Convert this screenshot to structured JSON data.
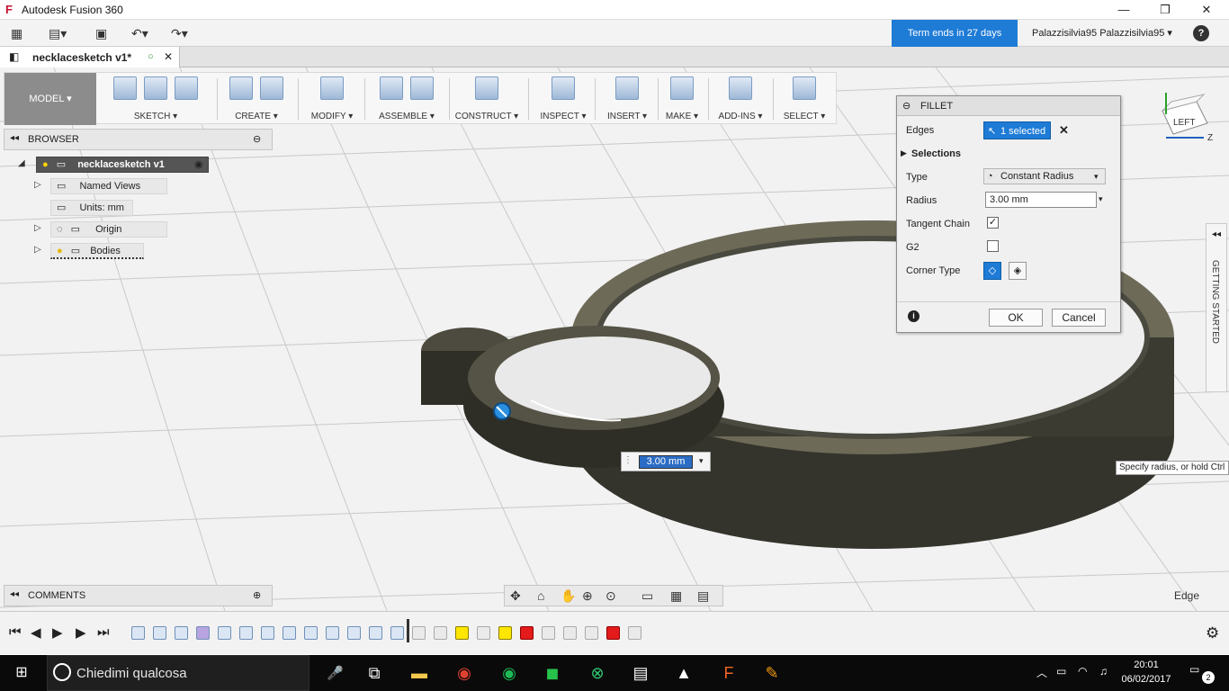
{
  "window": {
    "title": "Autodesk Fusion 360",
    "min": "—",
    "max": "❐",
    "close": "✕"
  },
  "appbar": {
    "term": "Term ends in 27 days",
    "user": "Palazzisilvia95 Palazzisilvia95 ▾",
    "help": "?"
  },
  "document": {
    "tab_name": "necklacesketch v1*"
  },
  "toolbar": {
    "workspace": "MODEL ▾",
    "groups": [
      "SKETCH ▾",
      "CREATE ▾",
      "MODIFY ▾",
      "ASSEMBLE ▾",
      "CONSTRUCT ▾",
      "INSPECT ▾",
      "INSERT ▾",
      "MAKE ▾",
      "ADD-INS ▾",
      "SELECT ▾"
    ]
  },
  "browser": {
    "title": "BROWSER",
    "root": "necklacesketch v1",
    "items": [
      "Named Views",
      "Units: mm",
      "Origin",
      "Bodies"
    ]
  },
  "viewcube": {
    "face": "LEFT",
    "axis": "Z"
  },
  "fillet": {
    "title": "FILLET",
    "edges_label": "Edges",
    "edges_value": "1 selected",
    "selections_label": "Selections",
    "type_label": "Type",
    "type_value": "Constant Radius",
    "radius_label": "Radius",
    "radius_value": "3.00 mm",
    "tangent_label": "Tangent Chain",
    "g2_label": "G2",
    "corner_label": "Corner Type",
    "ok": "OK",
    "cancel": "Cancel"
  },
  "getting_started": "GETTING STARTED",
  "tooltip": "Specify radius, or hold Ctrl",
  "dimension_input": "3.00 mm",
  "comments": {
    "title": "COMMENTS"
  },
  "status": {
    "selection_filter": "Edge"
  },
  "taskbar": {
    "search_placeholder": "Chiedimi qualcosa",
    "time": "20:01",
    "date": "06/02/2017",
    "notifications": "2"
  }
}
